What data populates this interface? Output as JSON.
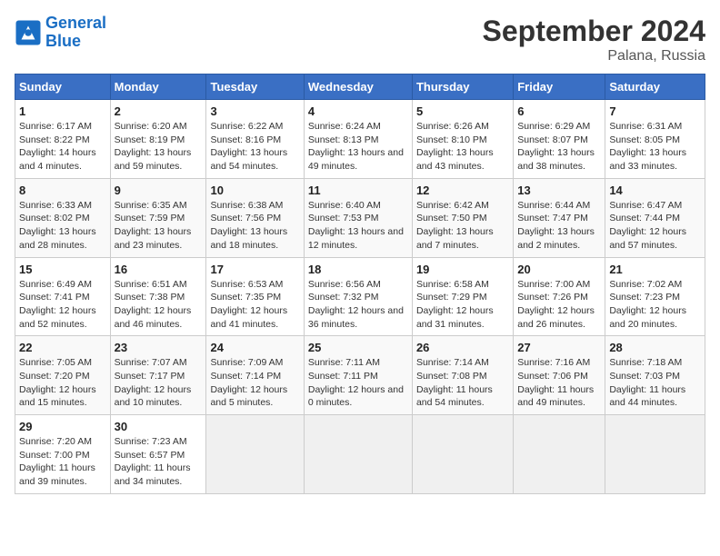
{
  "logo": {
    "line1": "General",
    "line2": "Blue"
  },
  "title": "September 2024",
  "subtitle": "Palana, Russia",
  "weekdays": [
    "Sunday",
    "Monday",
    "Tuesday",
    "Wednesday",
    "Thursday",
    "Friday",
    "Saturday"
  ],
  "weeks": [
    [
      {
        "day": "1",
        "sunrise": "6:17 AM",
        "sunset": "8:22 PM",
        "daylight": "14 hours and 4 minutes."
      },
      {
        "day": "2",
        "sunrise": "6:20 AM",
        "sunset": "8:19 PM",
        "daylight": "13 hours and 59 minutes."
      },
      {
        "day": "3",
        "sunrise": "6:22 AM",
        "sunset": "8:16 PM",
        "daylight": "13 hours and 54 minutes."
      },
      {
        "day": "4",
        "sunrise": "6:24 AM",
        "sunset": "8:13 PM",
        "daylight": "13 hours and 49 minutes."
      },
      {
        "day": "5",
        "sunrise": "6:26 AM",
        "sunset": "8:10 PM",
        "daylight": "13 hours and 43 minutes."
      },
      {
        "day": "6",
        "sunrise": "6:29 AM",
        "sunset": "8:07 PM",
        "daylight": "13 hours and 38 minutes."
      },
      {
        "day": "7",
        "sunrise": "6:31 AM",
        "sunset": "8:05 PM",
        "daylight": "13 hours and 33 minutes."
      }
    ],
    [
      {
        "day": "8",
        "sunrise": "6:33 AM",
        "sunset": "8:02 PM",
        "daylight": "13 hours and 28 minutes."
      },
      {
        "day": "9",
        "sunrise": "6:35 AM",
        "sunset": "7:59 PM",
        "daylight": "13 hours and 23 minutes."
      },
      {
        "day": "10",
        "sunrise": "6:38 AM",
        "sunset": "7:56 PM",
        "daylight": "13 hours and 18 minutes."
      },
      {
        "day": "11",
        "sunrise": "6:40 AM",
        "sunset": "7:53 PM",
        "daylight": "13 hours and 12 minutes."
      },
      {
        "day": "12",
        "sunrise": "6:42 AM",
        "sunset": "7:50 PM",
        "daylight": "13 hours and 7 minutes."
      },
      {
        "day": "13",
        "sunrise": "6:44 AM",
        "sunset": "7:47 PM",
        "daylight": "13 hours and 2 minutes."
      },
      {
        "day": "14",
        "sunrise": "6:47 AM",
        "sunset": "7:44 PM",
        "daylight": "12 hours and 57 minutes."
      }
    ],
    [
      {
        "day": "15",
        "sunrise": "6:49 AM",
        "sunset": "7:41 PM",
        "daylight": "12 hours and 52 minutes."
      },
      {
        "day": "16",
        "sunrise": "6:51 AM",
        "sunset": "7:38 PM",
        "daylight": "12 hours and 46 minutes."
      },
      {
        "day": "17",
        "sunrise": "6:53 AM",
        "sunset": "7:35 PM",
        "daylight": "12 hours and 41 minutes."
      },
      {
        "day": "18",
        "sunrise": "6:56 AM",
        "sunset": "7:32 PM",
        "daylight": "12 hours and 36 minutes."
      },
      {
        "day": "19",
        "sunrise": "6:58 AM",
        "sunset": "7:29 PM",
        "daylight": "12 hours and 31 minutes."
      },
      {
        "day": "20",
        "sunrise": "7:00 AM",
        "sunset": "7:26 PM",
        "daylight": "12 hours and 26 minutes."
      },
      {
        "day": "21",
        "sunrise": "7:02 AM",
        "sunset": "7:23 PM",
        "daylight": "12 hours and 20 minutes."
      }
    ],
    [
      {
        "day": "22",
        "sunrise": "7:05 AM",
        "sunset": "7:20 PM",
        "daylight": "12 hours and 15 minutes."
      },
      {
        "day": "23",
        "sunrise": "7:07 AM",
        "sunset": "7:17 PM",
        "daylight": "12 hours and 10 minutes."
      },
      {
        "day": "24",
        "sunrise": "7:09 AM",
        "sunset": "7:14 PM",
        "daylight": "12 hours and 5 minutes."
      },
      {
        "day": "25",
        "sunrise": "7:11 AM",
        "sunset": "7:11 PM",
        "daylight": "12 hours and 0 minutes."
      },
      {
        "day": "26",
        "sunrise": "7:14 AM",
        "sunset": "7:08 PM",
        "daylight": "11 hours and 54 minutes."
      },
      {
        "day": "27",
        "sunrise": "7:16 AM",
        "sunset": "7:06 PM",
        "daylight": "11 hours and 49 minutes."
      },
      {
        "day": "28",
        "sunrise": "7:18 AM",
        "sunset": "7:03 PM",
        "daylight": "11 hours and 44 minutes."
      }
    ],
    [
      {
        "day": "29",
        "sunrise": "7:20 AM",
        "sunset": "7:00 PM",
        "daylight": "11 hours and 39 minutes."
      },
      {
        "day": "30",
        "sunrise": "7:23 AM",
        "sunset": "6:57 PM",
        "daylight": "11 hours and 34 minutes."
      },
      null,
      null,
      null,
      null,
      null
    ]
  ]
}
